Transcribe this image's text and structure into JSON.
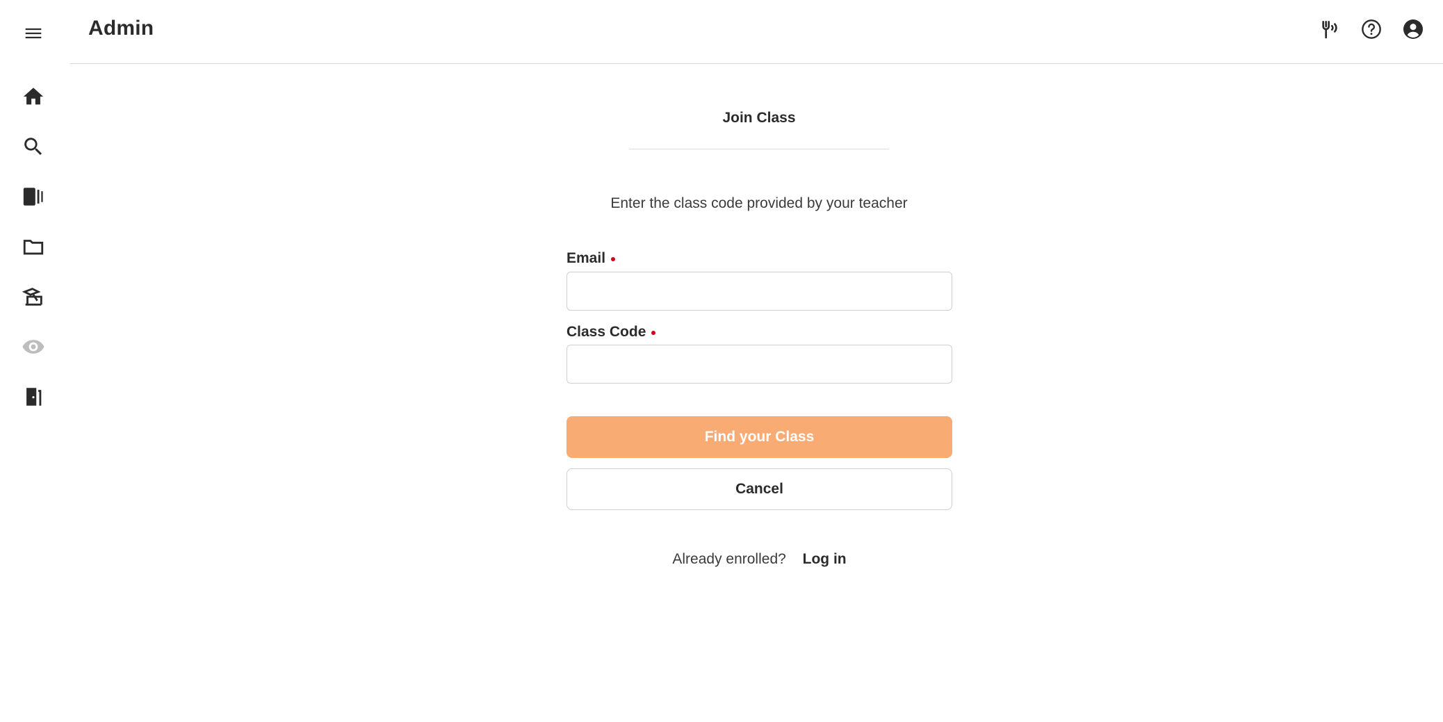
{
  "header": {
    "title": "Admin",
    "icons": [
      "audio-cast-icon",
      "help-icon",
      "account-icon"
    ]
  },
  "sidebar": {
    "items": [
      {
        "icon": "menu-icon",
        "label": "Menu"
      },
      {
        "icon": "home-icon",
        "label": "Home"
      },
      {
        "icon": "search-icon",
        "label": "Search"
      },
      {
        "icon": "library-icon",
        "label": "Library"
      },
      {
        "icon": "folder-icon",
        "label": "Folders"
      },
      {
        "icon": "graduation-icon",
        "label": "Classes"
      },
      {
        "icon": "eye-icon",
        "label": "Preview",
        "disabled": true
      },
      {
        "icon": "exit-door-icon",
        "label": "Exit"
      }
    ]
  },
  "form": {
    "title": "Join Class",
    "subtitle": "Enter the class code provided by your teacher",
    "email_label": "Email",
    "email_value": "",
    "class_code_label": "Class Code",
    "class_code_value": "",
    "submit_label": "Find your Class",
    "cancel_label": "Cancel",
    "footer_text": "Already enrolled?",
    "login_label": "Log in"
  },
  "colors": {
    "primary_button": "#f9ab74",
    "required_dot": "#d0021b",
    "text": "#2b2b2b",
    "disabled_icon": "#bdbdbd"
  }
}
